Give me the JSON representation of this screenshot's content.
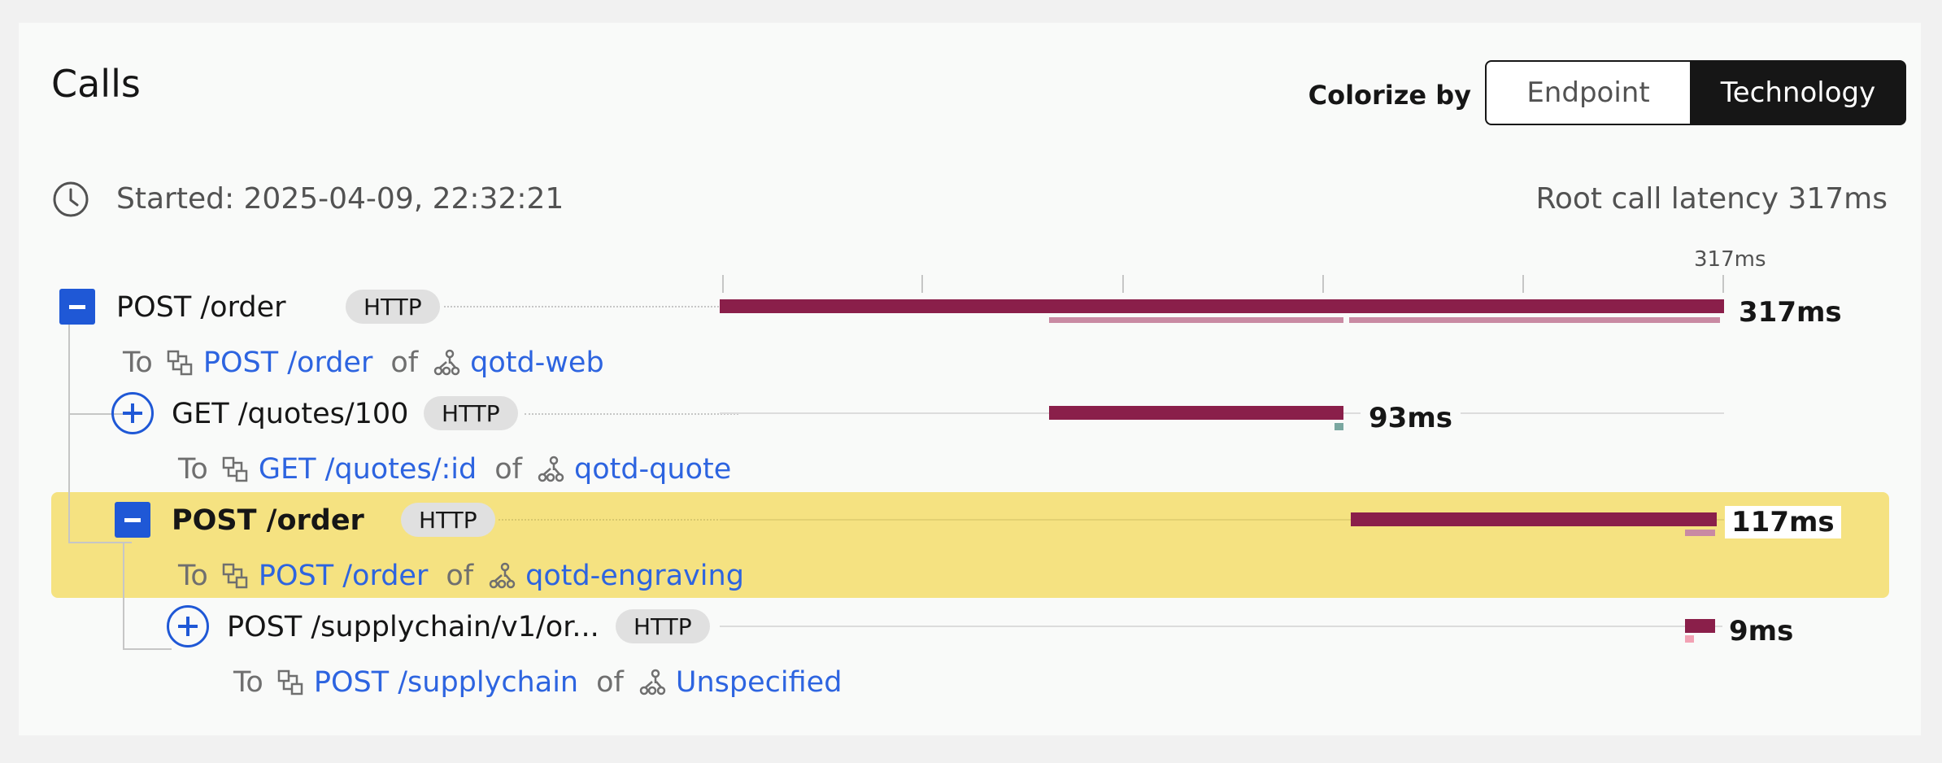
{
  "panel": {
    "title": "Calls"
  },
  "colorize": {
    "label": "Colorize by",
    "options": [
      "Endpoint",
      "Technology"
    ],
    "selected": "Technology"
  },
  "started": "Started: 2025-04-09, 22:32:21",
  "root_latency": "Root call latency 317ms",
  "ruler": {
    "max_label": "317ms"
  },
  "calls": [
    {
      "name": "POST /order",
      "badge": "HTTP",
      "duration": "317ms",
      "to": "To",
      "endpoint": "POST /order",
      "of": "of",
      "service": "qotd-web"
    },
    {
      "name": "GET /quotes/100",
      "badge": "HTTP",
      "duration": "93ms",
      "to": "To",
      "endpoint": "GET /quotes/:id",
      "of": "of",
      "service": "qotd-quote"
    },
    {
      "name": "POST /order",
      "badge": "HTTP",
      "duration": "117ms",
      "to": "To",
      "endpoint": "POST /order",
      "of": "of",
      "service": "qotd-engraving"
    },
    {
      "name": "POST /supplychain/v1/or...",
      "badge": "HTTP",
      "duration": "9ms",
      "to": "To",
      "endpoint": "POST /supplychain",
      "of": "of",
      "service": "Unspecified"
    }
  ],
  "colors": {
    "bar": "#8a1f4a",
    "bar_light": "#c98aa3",
    "highlight": "#f5e281",
    "link": "#2d64e0",
    "toggle": "#1f58d6"
  },
  "icons": {
    "clock": "clock-icon",
    "endpoint": "endpoint-icon",
    "service": "service-icon"
  }
}
